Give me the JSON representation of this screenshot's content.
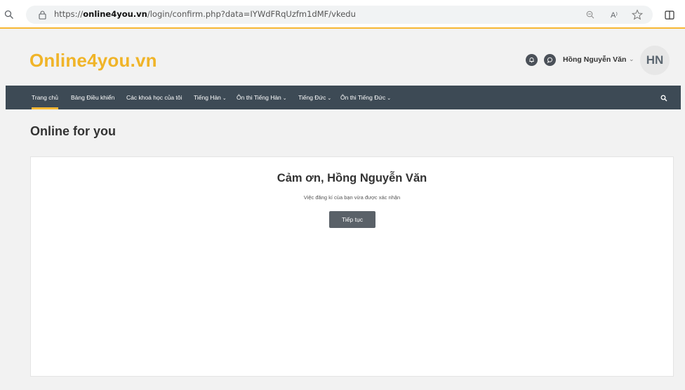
{
  "browser": {
    "url_prefix": "https://",
    "url_host": "online4you.vn",
    "url_path": "/login/confirm.php?data=IYWdFRqUzfm1dMF/vkedu",
    "read_aloud_icon_text": "A⁾"
  },
  "header": {
    "logo": "Online4you.vn",
    "username": "Hồng Nguyễn Văn",
    "user_caret": "⌄",
    "avatar_initials": "HN"
  },
  "nav": {
    "items": [
      {
        "label": "Trang chủ",
        "dropdown": ""
      },
      {
        "label": "Bảng Điều khiển",
        "dropdown": ""
      },
      {
        "label": "Các khoá học của tôi",
        "dropdown": ""
      },
      {
        "label": "Tiếng Hàn",
        "dropdown": "⌄"
      },
      {
        "label": "Ôn thi Tiếng Hàn",
        "dropdown": "⌄"
      },
      {
        "label": "Tiếng Đức",
        "dropdown": "⌄"
      },
      {
        "label": "Ôn thi Tiếng Đức",
        "dropdown": "⌄"
      }
    ]
  },
  "page": {
    "title": "Online for you",
    "heading": "Cảm ơn, Hồng Nguyễn Văn",
    "message": "Việc đăng kí của bạn vừa được xác nhận",
    "continue_label": "Tiếp tục"
  },
  "colors": {
    "accent": "#f7b733",
    "logo": "#f0b428",
    "navbar": "#3d4a55",
    "button": "#5a6168"
  }
}
